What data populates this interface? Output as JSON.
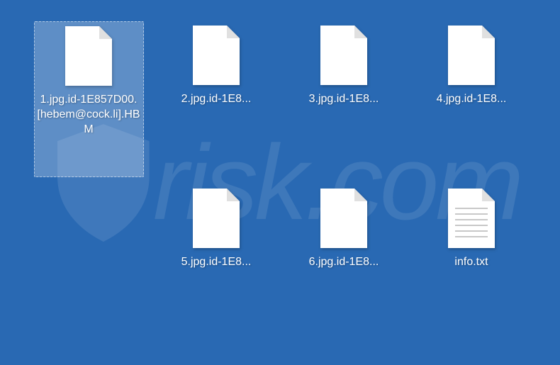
{
  "files": [
    {
      "label": "1.jpg.id-1E857D00.[hebem@cock.li].HBM",
      "selected": true,
      "type": "blank"
    },
    {
      "label": "2.jpg.id-1E8...",
      "selected": false,
      "type": "blank"
    },
    {
      "label": "3.jpg.id-1E8...",
      "selected": false,
      "type": "blank"
    },
    {
      "label": "4.jpg.id-1E8...",
      "selected": false,
      "type": "blank"
    },
    {
      "label": "",
      "selected": false,
      "type": "empty"
    },
    {
      "label": "5.jpg.id-1E8...",
      "selected": false,
      "type": "blank"
    },
    {
      "label": "6.jpg.id-1E8...",
      "selected": false,
      "type": "blank"
    },
    {
      "label": "info.txt",
      "selected": false,
      "type": "text"
    }
  ],
  "watermark": {
    "text": "risk.com"
  }
}
